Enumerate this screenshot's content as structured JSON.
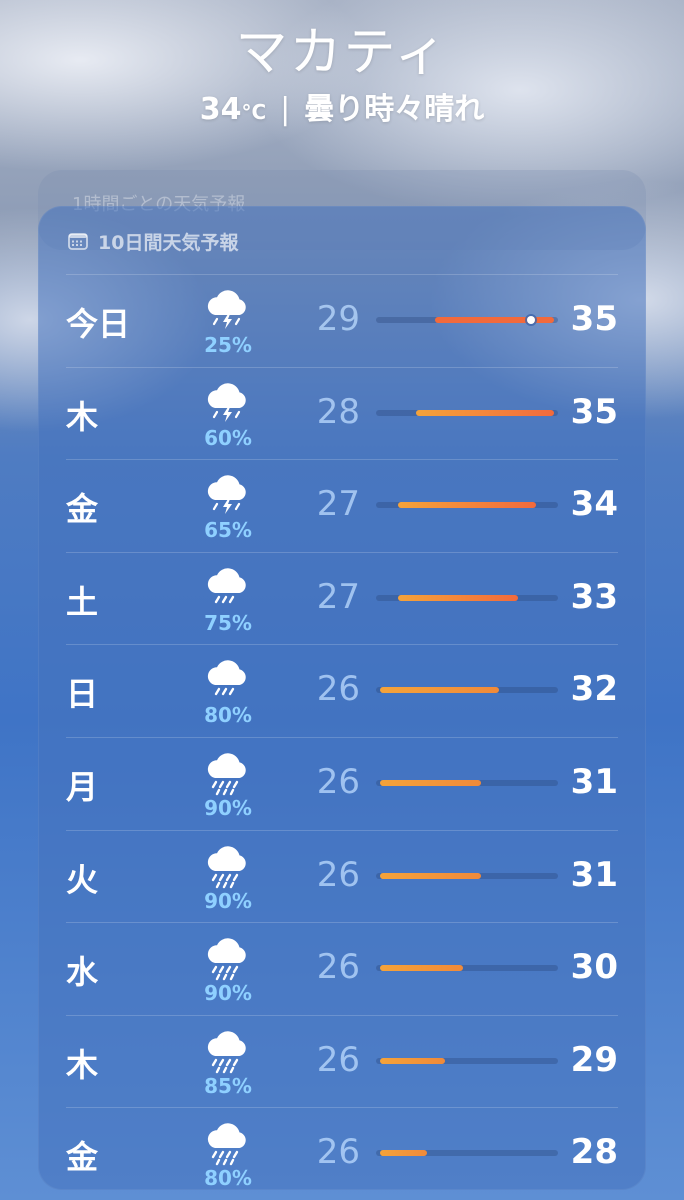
{
  "location": {
    "city": "マカティ",
    "temp": "34",
    "unit": "°C",
    "condition": "曇り時々晴れ"
  },
  "hourly_card": {
    "label": "1時間ごとの天気予報"
  },
  "forecast": {
    "title": "10日間天気予報",
    "icon": "calendar-icon",
    "week_min": 26,
    "week_max": 35,
    "current_temp": 34,
    "days": [
      {
        "day": "今日",
        "icon": "thunderstorm-icon",
        "precip": "25%",
        "low": "29",
        "high": "35"
      },
      {
        "day": "木",
        "icon": "thunderstorm-icon",
        "precip": "60%",
        "low": "28",
        "high": "35"
      },
      {
        "day": "金",
        "icon": "thunderstorm-icon",
        "precip": "65%",
        "low": "27",
        "high": "34"
      },
      {
        "day": "土",
        "icon": "rain-icon",
        "precip": "75%",
        "low": "27",
        "high": "33"
      },
      {
        "day": "日",
        "icon": "rain-icon",
        "precip": "80%",
        "low": "26",
        "high": "32"
      },
      {
        "day": "月",
        "icon": "heavy-rain-icon",
        "precip": "90%",
        "low": "26",
        "high": "31"
      },
      {
        "day": "火",
        "icon": "heavy-rain-icon",
        "precip": "90%",
        "low": "26",
        "high": "31"
      },
      {
        "day": "水",
        "icon": "heavy-rain-icon",
        "precip": "90%",
        "low": "26",
        "high": "30"
      },
      {
        "day": "木",
        "icon": "heavy-rain-icon",
        "precip": "85%",
        "low": "26",
        "high": "29"
      },
      {
        "day": "金",
        "icon": "heavy-rain-icon",
        "precip": "80%",
        "low": "26",
        "high": "28"
      }
    ]
  },
  "colors": {
    "bar_hot": "#f26a3c",
    "bar_warm": "#f5a33a",
    "precip": "#8fd0ff"
  }
}
